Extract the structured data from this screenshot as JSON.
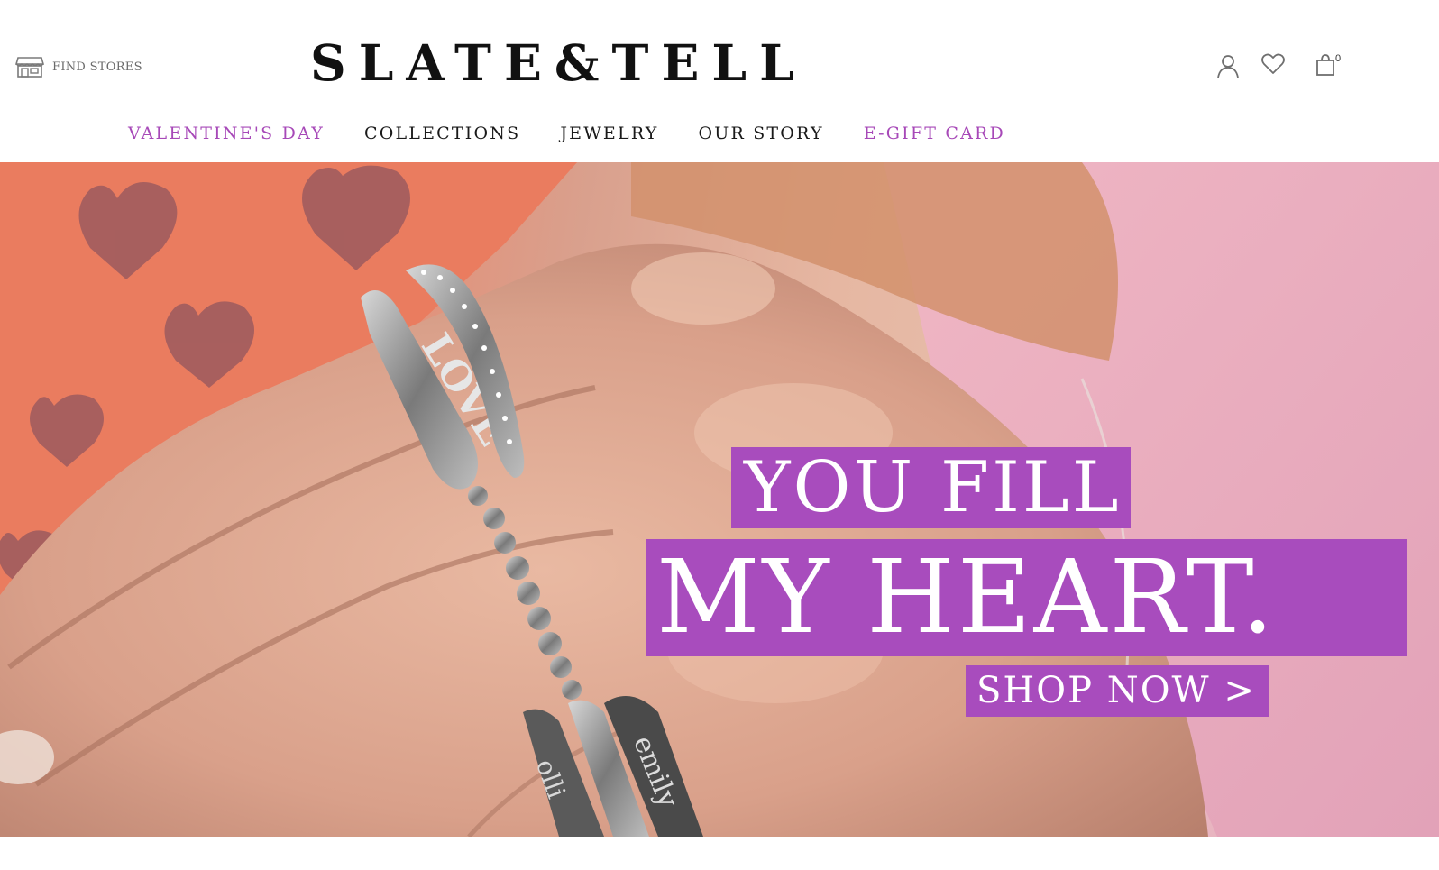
{
  "header": {
    "find_stores": "FIND STORES",
    "brand": "SLATE&TELL",
    "cart_count": "0",
    "icons": [
      "store-icon",
      "account-icon",
      "heart-icon",
      "shopping-bag-icon"
    ]
  },
  "nav": {
    "items": [
      {
        "label": "VALENTINE'S DAY",
        "accent": true
      },
      {
        "label": "COLLECTIONS",
        "accent": false
      },
      {
        "label": "JEWELRY",
        "accent": false
      },
      {
        "label": "OUR STORY",
        "accent": false
      },
      {
        "label": "E-GIFT CARD",
        "accent": true
      }
    ]
  },
  "hero": {
    "headline_line1": "YOU FILL",
    "headline_line2": "MY HEART.",
    "cta": "SHOP NOW >"
  },
  "colors": {
    "accent": "#a84cbd",
    "nav_accent": "#a749b8",
    "text": "#1a1a1a"
  }
}
